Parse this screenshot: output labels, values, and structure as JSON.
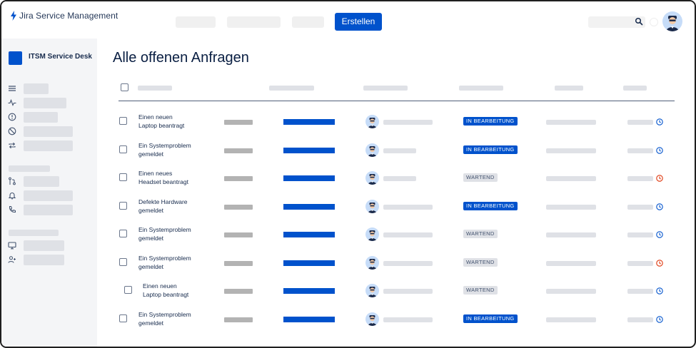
{
  "app": {
    "product_name": "Jira Service Management",
    "create_label": "Erstellen"
  },
  "sidebar": {
    "project_name": "ITSM Service Desk",
    "nav_icons": [
      "list-icon",
      "activity-icon",
      "alert-circle-icon",
      "block-icon",
      "repeat-icon",
      "branch-icon",
      "bell-icon",
      "phone-icon",
      "monitor-icon",
      "add-user-icon"
    ]
  },
  "main": {
    "title": "Alle offenen Anfragen"
  },
  "colors": {
    "accent": "#0052cc",
    "sidebar_bg": "#f4f5f7",
    "status_in_progress": "#0052cc",
    "status_waiting": "#dfe1e6",
    "clock_ok": "#0052cc",
    "clock_overdue": "#de350b"
  },
  "requests": [
    {
      "summary_line1": "Einen neuen",
      "summary_line2": "Laptop beantragt",
      "status": "IN BEARBEITUNG",
      "status_kind": "in-progress",
      "sla": "ok"
    },
    {
      "summary_line1": "Ein Systemproblem",
      "summary_line2": "gemeldet",
      "status": "IN BEARBEITUNG",
      "status_kind": "in-progress",
      "sla": "ok"
    },
    {
      "summary_line1": "Einen neues",
      "summary_line2": "Headset beantragt",
      "status": "WARTEND",
      "status_kind": "waiting",
      "sla": "overdue"
    },
    {
      "summary_line1": "Defekte Hardware",
      "summary_line2": "gemeldet",
      "status": "IN BEARBEITUNG",
      "status_kind": "in-progress",
      "sla": "ok"
    },
    {
      "summary_line1": "Ein Systemproblem",
      "summary_line2": "gemeldet",
      "status": "WARTEND",
      "status_kind": "waiting",
      "sla": "ok"
    },
    {
      "summary_line1": "Ein Systemproblem",
      "summary_line2": "gemeldet",
      "status": "WARTEND",
      "status_kind": "waiting",
      "sla": "overdue"
    },
    {
      "summary_line1": "Einen neuen",
      "summary_line2": "Laptop beantragt",
      "status": "WARTEND",
      "status_kind": "waiting",
      "sla": "ok"
    },
    {
      "summary_line1": "Ein Systemproblem",
      "summary_line2": "gemeldet",
      "status": "IN BEARBEITUNG",
      "status_kind": "in-progress",
      "sla": "ok"
    }
  ]
}
